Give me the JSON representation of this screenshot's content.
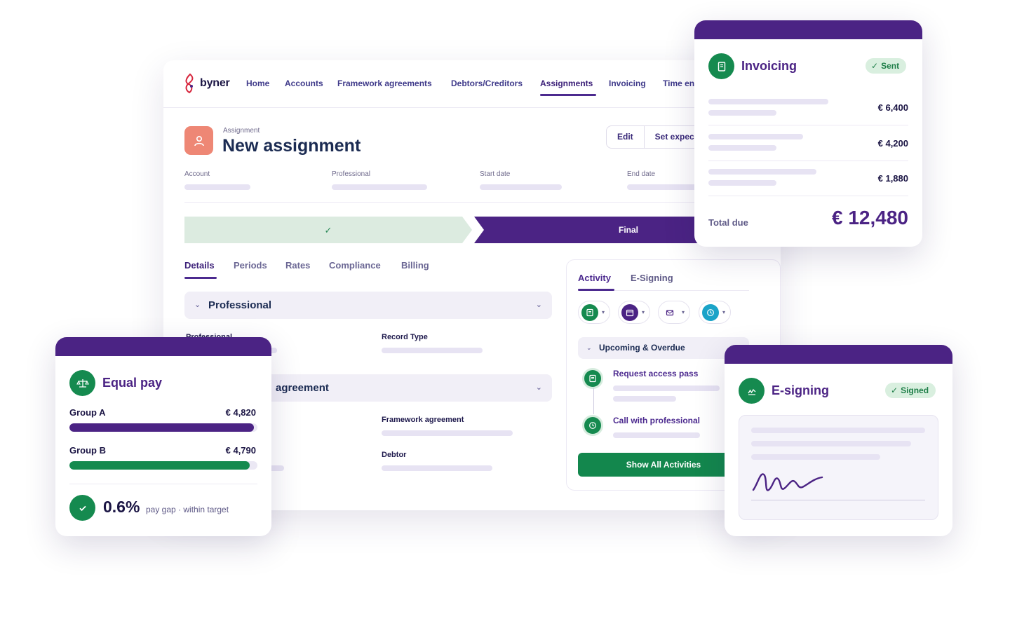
{
  "brand": {
    "name": "byner",
    "primary": "#4b2384",
    "green": "#158a4f",
    "coral": "#ee8775"
  },
  "nav": {
    "items": [
      {
        "label": "Home"
      },
      {
        "label": "Accounts"
      },
      {
        "label": "Framework agreements"
      },
      {
        "label": "Debtors/Creditors"
      },
      {
        "label": "Assignments",
        "active": true
      },
      {
        "label": "Invoicing"
      },
      {
        "label": "Time en"
      }
    ]
  },
  "assignment": {
    "breadcrumb": "Assignment",
    "title": "New assignment",
    "icon": "user-icon",
    "actions": {
      "edit": "Edit",
      "set_expected": "Set expec"
    },
    "meta": {
      "account": "Account",
      "professional": "Professional",
      "start_date": "Start date",
      "end_date": "End date"
    }
  },
  "stages": {
    "done_icon": "check-icon",
    "final": "Final"
  },
  "tabs": [
    "Details",
    "Periods",
    "Rates",
    "Compliance",
    "Billing"
  ],
  "sections": {
    "professional": {
      "title": "Professional",
      "left_field": "Professional",
      "right_field": "Record Type"
    },
    "agreement": {
      "title": "agreement",
      "right_field_1": "Framework agreement",
      "right_field_2": "Debtor"
    }
  },
  "activity": {
    "tabs": [
      "Activity",
      "E-Signing"
    ],
    "filters": [
      "note-icon",
      "calendar-icon",
      "mail-icon",
      "clock-icon"
    ],
    "group": "Upcoming & Overdue",
    "items": [
      {
        "title": "Request access pass",
        "icon": "note-icon"
      },
      {
        "title": "Call with professional",
        "icon": "clock-icon"
      }
    ],
    "show_all": "Show All Activities"
  },
  "invoicing": {
    "title": "Invoicing",
    "status": "Sent",
    "lines": [
      "€ 6,400",
      "€ 4,200",
      "€ 1,880"
    ],
    "total_label": "Total due",
    "total": "€ 12,480"
  },
  "equal_pay": {
    "title": "Equal pay",
    "groups": [
      {
        "label": "Group A",
        "value": "€ 4,820",
        "fill": 0.98,
        "color": "#4b2384"
      },
      {
        "label": "Group B",
        "value": "€ 4,790",
        "fill": 0.96,
        "color": "#158a4f"
      }
    ],
    "gap": "0.6%",
    "gap_note": "pay gap · within target"
  },
  "esigning": {
    "title": "E-signing",
    "status": "Signed"
  }
}
